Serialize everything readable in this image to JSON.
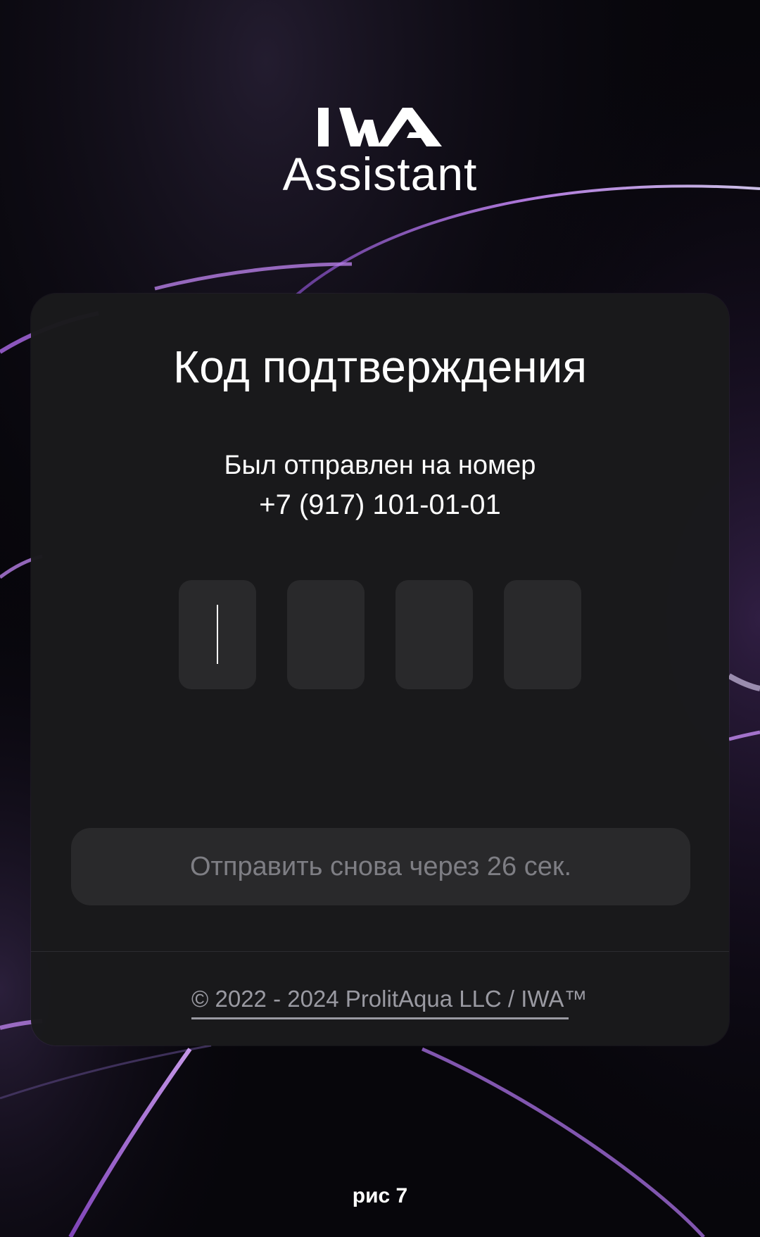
{
  "brand": {
    "logo_text": "IWA",
    "app_name": "Assistant"
  },
  "card": {
    "title": "Код подтверждения",
    "subtitle": "Был отправлен на номер",
    "phone": "+7 (917) 101-01-01",
    "code_digits": [
      "",
      "",
      "",
      ""
    ],
    "resend_label": "Отправить снова через 26 сек.",
    "footer": "© 2022 - 2024 ProlitAqua LLC / IWA™"
  },
  "caption": "рис 7",
  "colors": {
    "background": "#07060b",
    "card": "#1a1a1c",
    "input": "#29292b",
    "accent_purple": "#b77ee6",
    "muted_text": "#7e7e84"
  }
}
